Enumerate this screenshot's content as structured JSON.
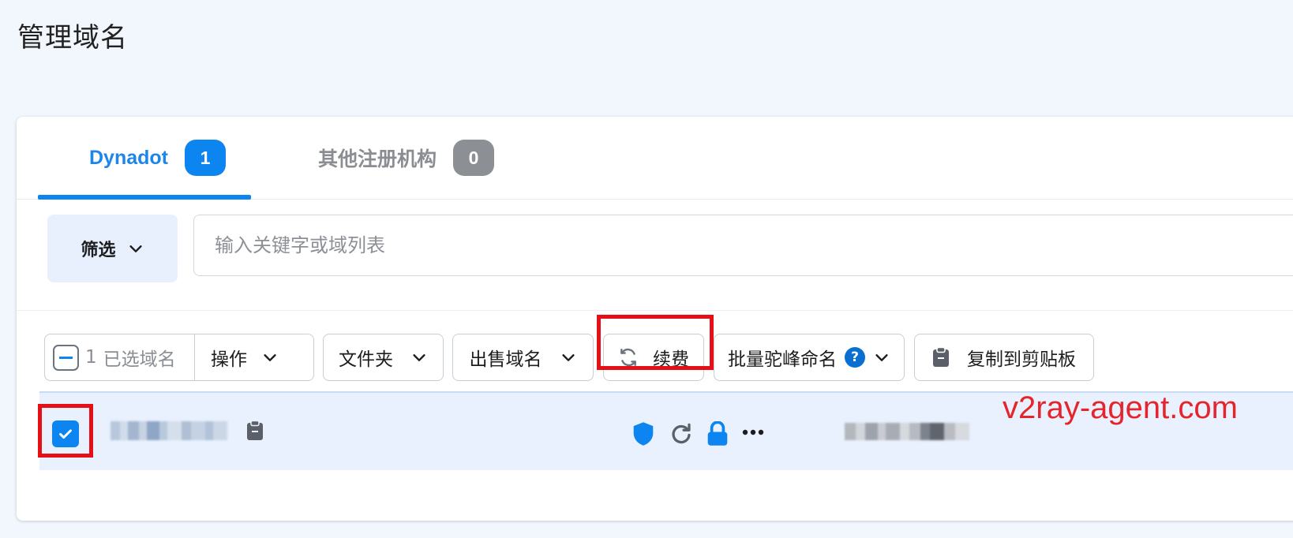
{
  "page": {
    "title": "管理域名"
  },
  "tabs": [
    {
      "label": "Dynadot",
      "count": "1",
      "active": true
    },
    {
      "label": "其他注册机构",
      "count": "0",
      "active": false
    }
  ],
  "filter": {
    "label": "筛选"
  },
  "search": {
    "placeholder": "输入关键字或域列表"
  },
  "toolbar": {
    "selected_count": "1",
    "selected_label": "已选域名",
    "actions_label": "操作",
    "folder_label": "文件夹",
    "sell_label": "出售域名",
    "renew_label": "续费",
    "bulk_camel_label": "批量驼峰命名",
    "copy_label": "复制到剪贴板"
  },
  "row": {
    "checked": true,
    "domain_redacted": true,
    "status_icons": [
      "shield-icon",
      "refresh-icon",
      "lock-icon",
      "more-icon"
    ]
  },
  "watermark": "v2ray-agent.com",
  "colors": {
    "accent": "#0c85f0",
    "highlight": "#e50f15",
    "row_bg": "#e8f1fd",
    "page_bg": "#f2f7fd"
  }
}
